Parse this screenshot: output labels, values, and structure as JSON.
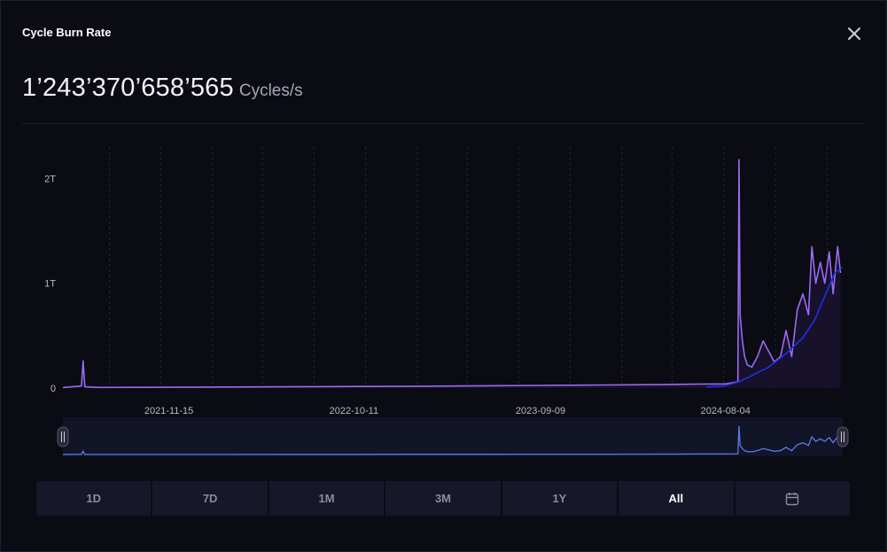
{
  "modal": {
    "title": "Cycle Burn Rate",
    "close_icon": "close-icon",
    "value": "1’243’370’658’565",
    "unit": "Cycles/s"
  },
  "ranges": [
    {
      "label": "1D",
      "active": false
    },
    {
      "label": "7D",
      "active": false
    },
    {
      "label": "1M",
      "active": false
    },
    {
      "label": "3M",
      "active": false
    },
    {
      "label": "1Y",
      "active": false
    },
    {
      "label": "All",
      "active": true
    },
    {
      "label": "",
      "icon": "calendar-icon",
      "active": false
    }
  ],
  "chart_data": {
    "type": "line",
    "x_tick_labels": [
      "2021-11-15",
      "2022-10-11",
      "2023-09-09",
      "2024-08-04"
    ],
    "y_tick_labels": [
      "0",
      "1T",
      "2T"
    ],
    "y_ticks": [
      0,
      1000000000000,
      2000000000000
    ],
    "ylim": [
      0,
      2300000000000
    ],
    "xlim": [
      "2021-05-10",
      "2025-03-01"
    ],
    "grid": "vertical-dashed",
    "colors": {
      "main": "#9b6bf0",
      "trend": "#1f2fe8",
      "navigator": "#5b7ce8",
      "grid": "#23232f"
    },
    "series": [
      {
        "kind": "burn_rate",
        "x": [
          "2021-05-10",
          "2021-06-12",
          "2021-06-15",
          "2021-06-18",
          "2021-07-15",
          "2021-09-01",
          "2021-11-15",
          "2022-03-01",
          "2022-06-01",
          "2022-10-11",
          "2023-02-01",
          "2023-06-01",
          "2023-09-09",
          "2024-01-01",
          "2024-05-01",
          "2024-06-15",
          "2024-08-04",
          "2024-08-26",
          "2024-08-28",
          "2024-08-30",
          "2024-09-03",
          "2024-09-07",
          "2024-09-12",
          "2024-09-20",
          "2024-09-30",
          "2024-10-10",
          "2024-10-20",
          "2024-10-30",
          "2024-11-10",
          "2024-11-20",
          "2024-11-30",
          "2024-12-10",
          "2024-12-20",
          "2024-12-30",
          "2025-01-05",
          "2025-01-12",
          "2025-01-20",
          "2025-01-28",
          "2025-02-05",
          "2025-02-12",
          "2025-02-20",
          "2025-02-25"
        ],
        "y": [
          5000000000,
          20000000000,
          260000000000,
          12000000000,
          6000000000,
          7000000000,
          8000000000,
          10000000000,
          12000000000,
          15000000000,
          18000000000,
          22000000000,
          25000000000,
          30000000000,
          35000000000,
          38000000000,
          40000000000,
          60000000000,
          2180000000000,
          700000000000,
          450000000000,
          300000000000,
          220000000000,
          200000000000,
          300000000000,
          450000000000,
          350000000000,
          250000000000,
          300000000000,
          550000000000,
          300000000000,
          750000000000,
          900000000000,
          700000000000,
          1350000000000,
          1000000000000,
          1200000000000,
          1000000000000,
          1300000000000,
          900000000000,
          1350000000000,
          1100000000000
        ]
      },
      {
        "kind": "trend",
        "x": [
          "2024-07-01",
          "2024-08-01",
          "2024-08-28",
          "2024-09-20",
          "2024-10-20",
          "2024-11-20",
          "2024-12-20",
          "2025-01-10",
          "2025-01-30",
          "2025-02-15",
          "2025-02-28"
        ],
        "y": [
          10000000000,
          20000000000,
          60000000000,
          120000000000,
          200000000000,
          330000000000,
          480000000000,
          650000000000,
          900000000000,
          1100000000000,
          1150000000000
        ]
      }
    ]
  }
}
